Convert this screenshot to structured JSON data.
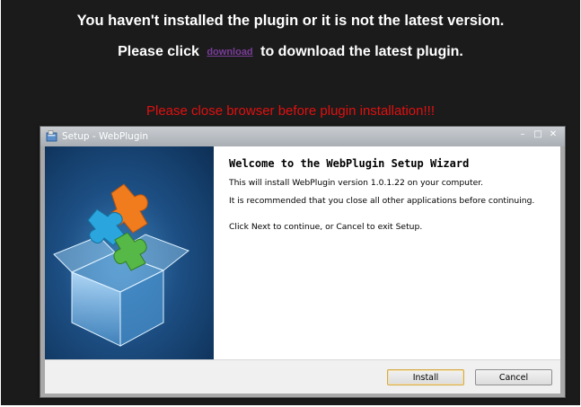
{
  "message": {
    "line1": "You haven't installed the plugin or it is not the latest version.",
    "line2_before": "Please click",
    "download_link": "download",
    "line2_after": "to download the latest plugin.",
    "warning": "Please close browser before plugin installation!!!"
  },
  "window": {
    "title": "Setup - WebPlugin",
    "minimize_glyph": "–",
    "maximize_glyph": "□",
    "close_glyph": "✕"
  },
  "wizard": {
    "heading": "Welcome to the WebPlugin Setup Wizard",
    "para1": "This will install WebPlugin version 1.0.1.22 on your computer.",
    "para2": "It is recommended that you close all other applications before continuing.",
    "para3": "Click Next to continue, or Cancel to exit Setup."
  },
  "buttons": {
    "install": "Install",
    "cancel": "Cancel"
  },
  "colors": {
    "page_bg": "#1b1b1b",
    "warning": "#e01010",
    "link": "#7a3d9a"
  }
}
